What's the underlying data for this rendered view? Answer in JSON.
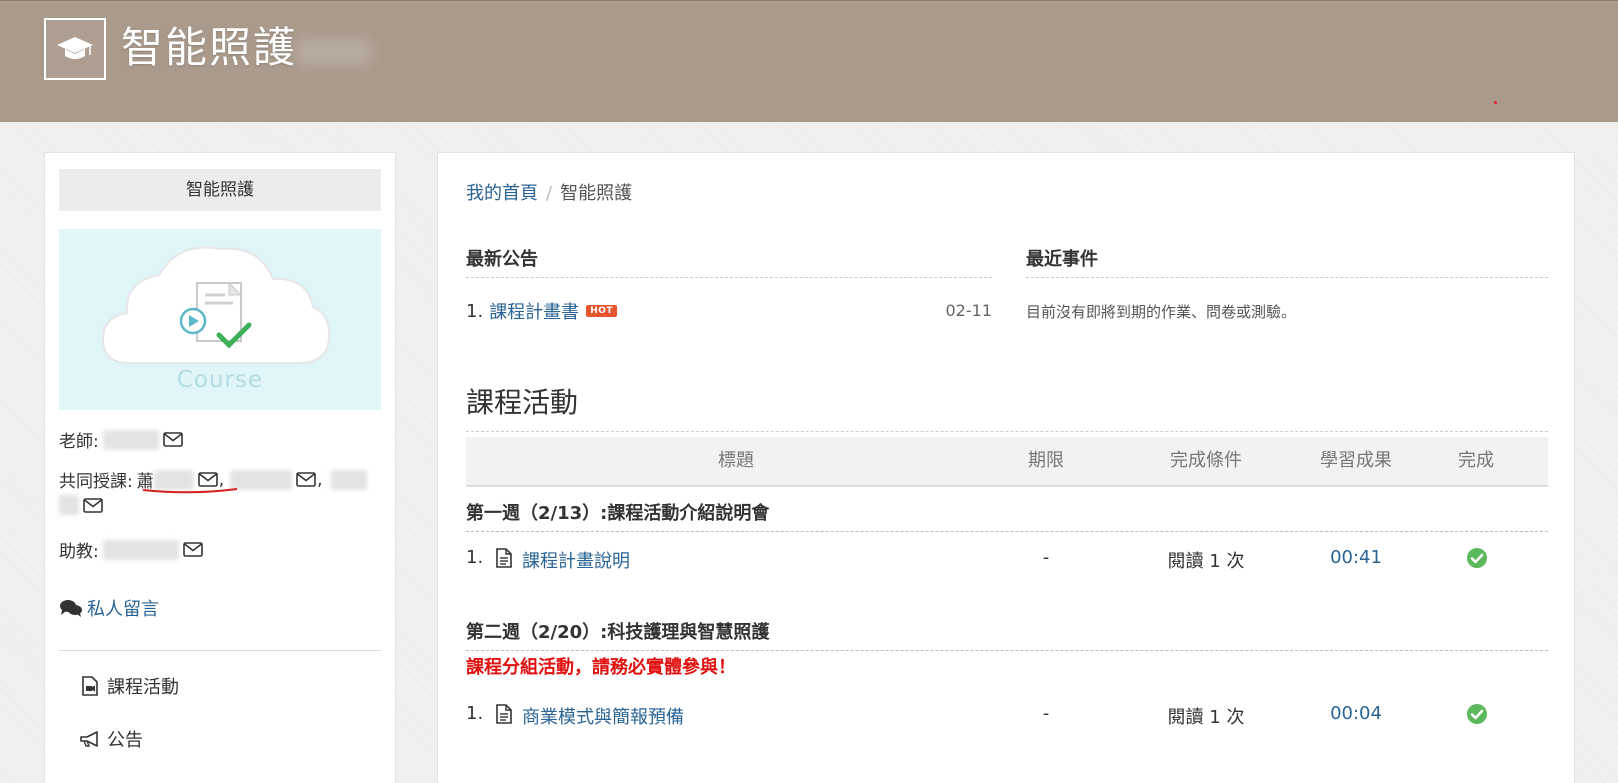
{
  "header": {
    "site_title": "智能照護"
  },
  "sidebar": {
    "course_title": "智能照護",
    "course_image_text": "Course",
    "teacher_label": "老師:",
    "co_teacher_label": "共同授課:",
    "co_teacher_first_char": "蕭",
    "ta_label": "助教:",
    "private_message": "私人留言",
    "nav": [
      {
        "label": "課程活動",
        "icon": "file-video-icon"
      },
      {
        "label": "公告",
        "icon": "megaphone-icon"
      }
    ]
  },
  "main": {
    "breadcrumb": {
      "home": "我的首頁",
      "separator": "/",
      "current": "智能照護"
    },
    "announcements": {
      "heading": "最新公告",
      "items": [
        {
          "num": "1.",
          "title": "課程計畫書",
          "badge": "HOT",
          "date": "02-11"
        }
      ]
    },
    "events": {
      "heading": "最近事件",
      "empty_text": "目前沒有即將到期的作業、問卷或測驗。"
    },
    "activities": {
      "heading": "課程活動",
      "columns": [
        "標題",
        "期限",
        "完成條件",
        "學習成果",
        "完成"
      ],
      "weeks": [
        {
          "title": "第一週（2/13）:課程活動介紹說明會",
          "note": "",
          "items": [
            {
              "num": "1.",
              "title": "課程計畫說明",
              "deadline": "-",
              "condition": "閱讀 1 次",
              "result": "00:41",
              "done": true
            }
          ]
        },
        {
          "title": "第二週（2/20）:科技護理與智慧照護",
          "note": "課程分組活動，請務必實體參與！",
          "items": [
            {
              "num": "1.",
              "title": "商業模式與簡報預備",
              "deadline": "-",
              "condition": "閱讀 1 次",
              "result": "00:04",
              "done": true
            }
          ]
        }
      ]
    }
  },
  "colors": {
    "header_bg": "#a99a8c",
    "link": "#2a6496",
    "accent_red": "#e01010",
    "check_green": "#5cb85c"
  }
}
